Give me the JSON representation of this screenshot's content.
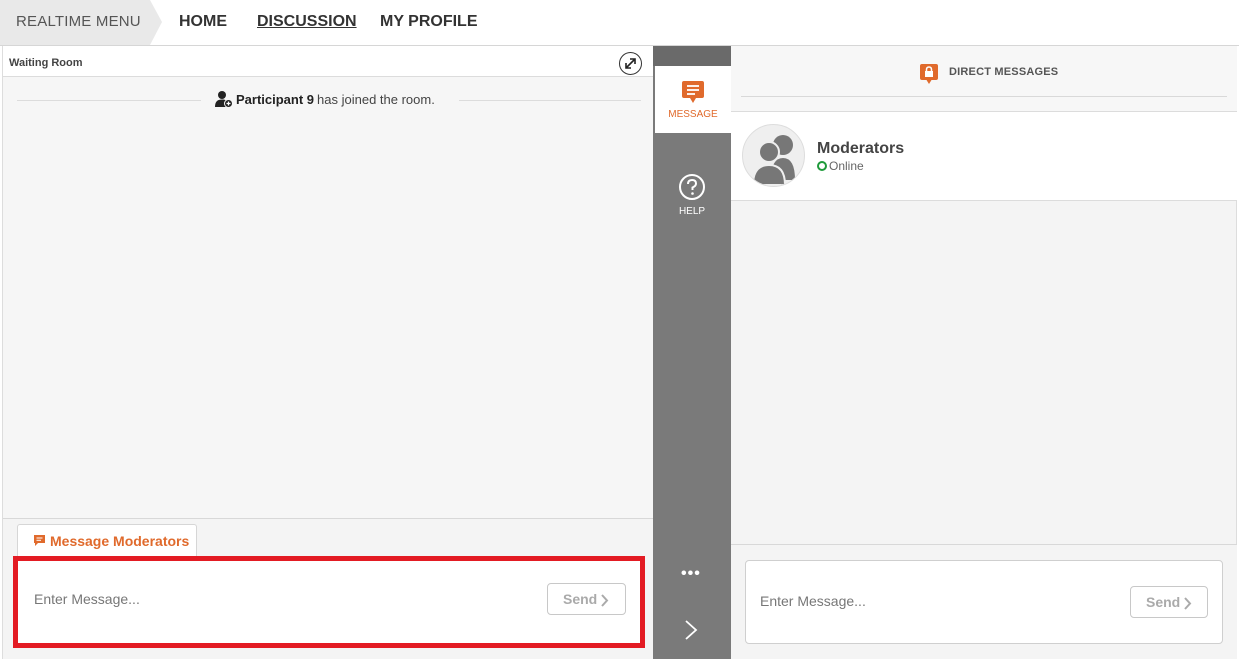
{
  "nav": {
    "realtime_menu": "REALTIME MENU",
    "home": "HOME",
    "discussion": "DISCUSSION",
    "my_profile": "MY PROFILE"
  },
  "room": {
    "title": "Waiting Room",
    "system_message": {
      "participant": "Participant 9",
      "text": "has joined the room."
    }
  },
  "compose_left": {
    "tab_label": "Message Moderators",
    "placeholder": "Enter Message...",
    "send_label": "Send"
  },
  "sidebar": {
    "message_label": "MESSAGE",
    "help_label": "HELP",
    "more_label": "•••"
  },
  "direct_messages": {
    "title": "DIRECT MESSAGES",
    "contact": {
      "name": "Moderators",
      "status": "Online"
    }
  },
  "compose_right": {
    "placeholder": "Enter Message...",
    "send_label": "Send"
  },
  "colors": {
    "accent": "#e06a2c",
    "highlight_border": "#e31b23",
    "online": "#1e9a3a",
    "sidebar_bg": "#7a7a7a"
  }
}
